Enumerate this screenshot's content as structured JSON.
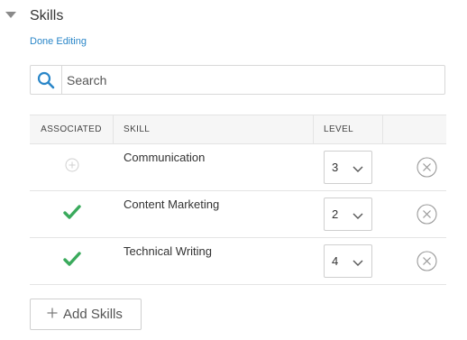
{
  "section": {
    "title": "Skills",
    "done_editing": "Done Editing"
  },
  "search": {
    "placeholder": "Search",
    "value": ""
  },
  "table": {
    "headers": {
      "associated": "ASSOCIATED",
      "skill": "SKILL",
      "level": "LEVEL"
    },
    "rows": [
      {
        "associated": false,
        "skill": "Communication",
        "level": "3"
      },
      {
        "associated": true,
        "skill": "Content Marketing",
        "level": "2"
      },
      {
        "associated": true,
        "skill": "Technical Writing",
        "level": "4"
      }
    ]
  },
  "add_skills_label": "Add Skills",
  "colors": {
    "accent": "#2a86c8",
    "check": "#3aaa5c",
    "border": "#e4e4e4"
  },
  "icons": {
    "collapse": "caret-down-icon",
    "search": "search-icon",
    "add_associate": "plus-circle-icon",
    "associated": "checkmark-icon",
    "dropdown": "chevron-down-icon",
    "remove": "close-circle-icon",
    "add": "plus-icon"
  }
}
